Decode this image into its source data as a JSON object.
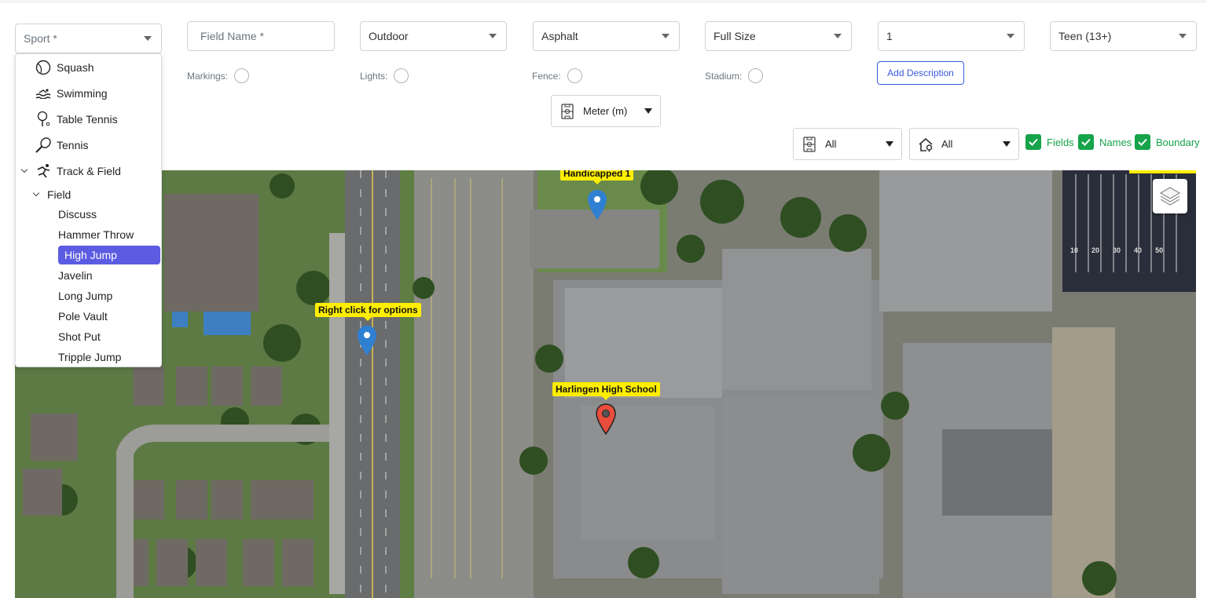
{
  "form": {
    "sport_placeholder": "Sport *",
    "field_name_placeholder": "Field Name *",
    "environment": "Outdoor",
    "surface": "Asphalt",
    "size": "Full Size",
    "count": "1",
    "age_group": "Teen (13+)",
    "markings_label": "Markings:",
    "lights_label": "Lights:",
    "fence_label": "Fence:",
    "stadium_label": "Stadium:",
    "add_description": "Add Description",
    "unit": "Meter (m)"
  },
  "filters": {
    "field_filter": "All",
    "facility_filter": "All",
    "fields_label": "Fields",
    "names_label": "Names",
    "boundary_label": "Boundary"
  },
  "sport_dropdown": {
    "items": [
      {
        "label": "Squash",
        "icon": "squash-ball-icon"
      },
      {
        "label": "Swimming",
        "icon": "swimming-icon"
      },
      {
        "label": "Table Tennis",
        "icon": "table-tennis-icon"
      },
      {
        "label": "Tennis",
        "icon": "tennis-racket-icon"
      },
      {
        "label": "Track & Field",
        "icon": "runner-icon"
      }
    ],
    "group": "Field",
    "sub_items": [
      "Discuss",
      "Hammer Throw",
      "High Jump",
      "Javelin",
      "Long Jump",
      "Pole Vault",
      "Shot Put",
      "Tripple Jump"
    ],
    "selected": "High Jump"
  },
  "map": {
    "markers": [
      {
        "label": "Handicapped 1",
        "color": "#2f80d0"
      },
      {
        "label": "Right click for options",
        "color": "#2f80d0"
      },
      {
        "label": "Harlingen High School",
        "color": "#e74c3c"
      }
    ],
    "field_numbers": [
      "10",
      "20",
      "30",
      "40",
      "50"
    ]
  },
  "colors": {
    "accent": "#5b5ce2",
    "check": "#16a34a",
    "link": "#3b5bdb",
    "tag": "#ffee00"
  }
}
